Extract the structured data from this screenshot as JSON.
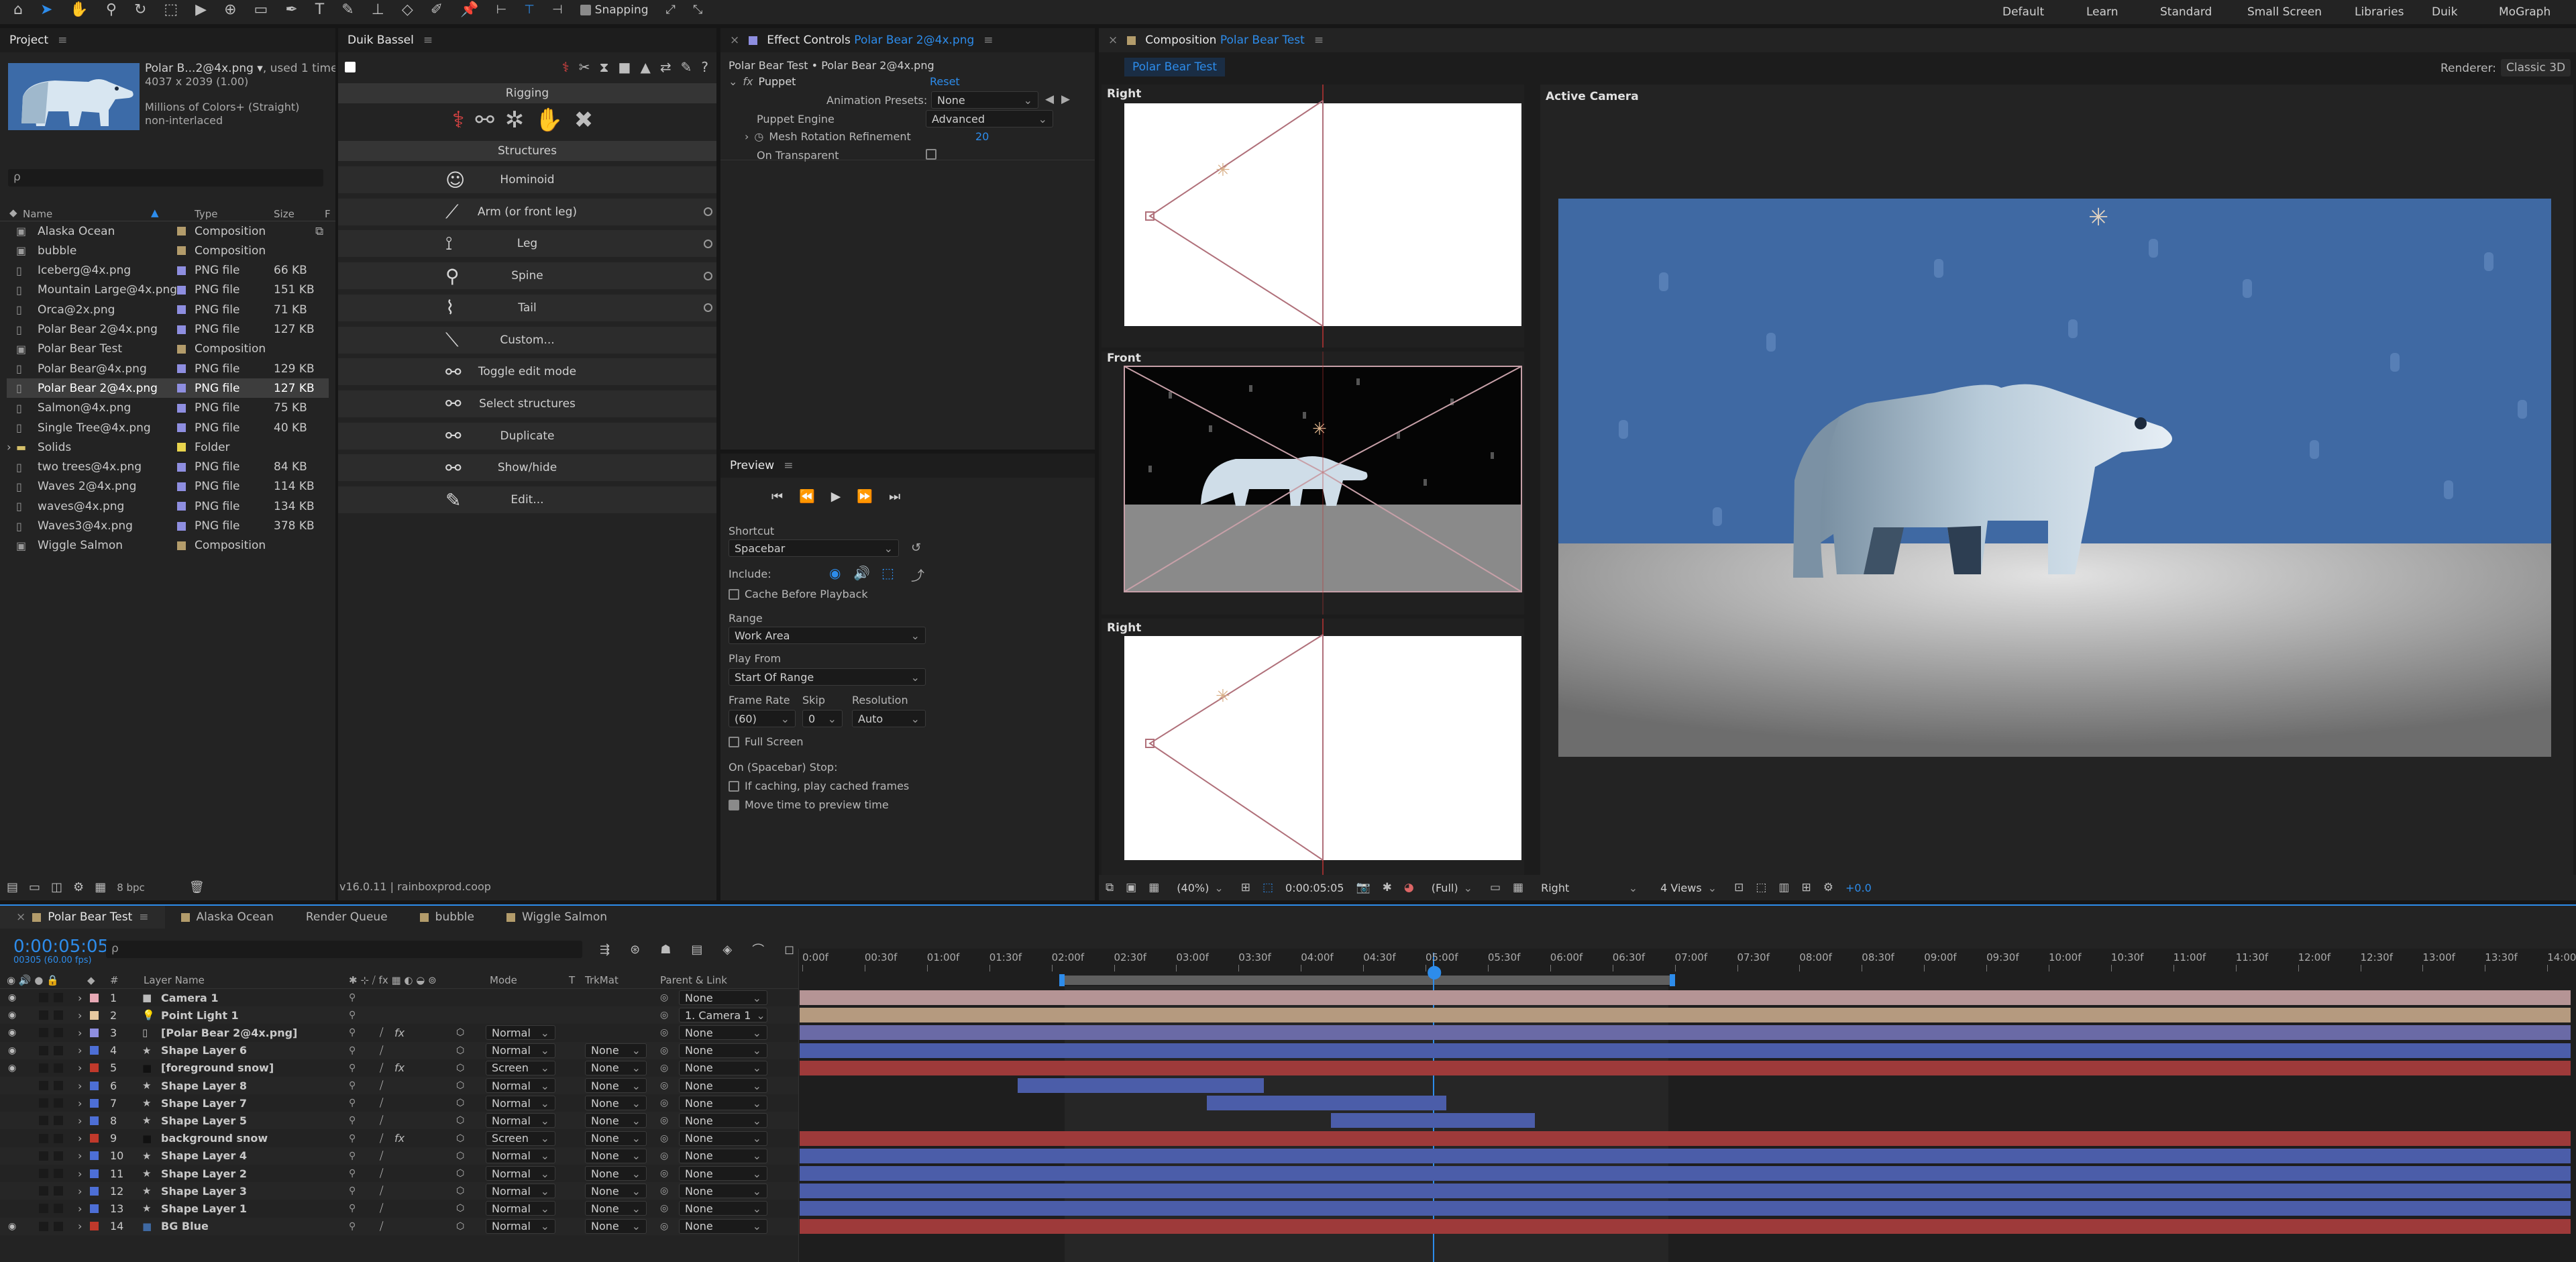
{
  "workspaces": [
    "Default",
    "Learn",
    "Standard",
    "Small Screen",
    "Libraries",
    "Duik",
    "MoGraph"
  ],
  "snapping_label": "Snapping",
  "project": {
    "tab": "Project",
    "filename": "Polar B...2@4x.png ▾",
    "used": ", used 1 time",
    "dims": "4037 x 2039 (1.00)",
    "colors": "Millions of Colors+ (Straight)",
    "interlace": "non-interlaced",
    "search_placeholder": "ρ",
    "col_name": "Name",
    "col_type": "Type",
    "col_size": "Size",
    "col_f": "F",
    "items": [
      {
        "name": "Alaska Ocean",
        "type": "Composition",
        "size": "",
        "color": "#b39c6b",
        "icon": "comp"
      },
      {
        "name": "bubble",
        "type": "Composition",
        "size": "",
        "color": "#b39c6b",
        "icon": "comp"
      },
      {
        "name": "Iceberg@4x.png",
        "type": "PNG file",
        "size": "66 KB",
        "color": "#8e8ee0",
        "icon": "file"
      },
      {
        "name": "Mountain Large@4x.png",
        "type": "PNG file",
        "size": "151 KB",
        "color": "#8e8ee0",
        "icon": "file"
      },
      {
        "name": "Orca@2x.png",
        "type": "PNG file",
        "size": "71 KB",
        "color": "#8e8ee0",
        "icon": "file"
      },
      {
        "name": "Polar Bear 2@4x.png",
        "type": "PNG file",
        "size": "127 KB",
        "color": "#8e8ee0",
        "icon": "file"
      },
      {
        "name": "Polar Bear Test",
        "type": "Composition",
        "size": "",
        "color": "#b39c6b",
        "icon": "comp"
      },
      {
        "name": "Polar Bear@4x.png",
        "type": "PNG file",
        "size": "129 KB",
        "color": "#8e8ee0",
        "icon": "file"
      },
      {
        "name": "Polar Bear 2@4x.png",
        "type": "PNG file",
        "size": "127 KB",
        "color": "#8e8ee0",
        "icon": "file",
        "selected": true
      },
      {
        "name": "Salmon@4x.png",
        "type": "PNG file",
        "size": "75 KB",
        "color": "#8e8ee0",
        "icon": "file"
      },
      {
        "name": "Single Tree@4x.png",
        "type": "PNG file",
        "size": "40 KB",
        "color": "#8e8ee0",
        "icon": "file"
      },
      {
        "name": "Solids",
        "type": "Folder",
        "size": "",
        "color": "#e8d44d",
        "icon": "folder"
      },
      {
        "name": "two trees@4x.png",
        "type": "PNG file",
        "size": "84 KB",
        "color": "#8e8ee0",
        "icon": "file"
      },
      {
        "name": "Waves 2@4x.png",
        "type": "PNG file",
        "size": "114 KB",
        "color": "#8e8ee0",
        "icon": "file"
      },
      {
        "name": "waves@4x.png",
        "type": "PNG file",
        "size": "134 KB",
        "color": "#8e8ee0",
        "icon": "file"
      },
      {
        "name": "Waves3@4x.png",
        "type": "PNG file",
        "size": "378 KB",
        "color": "#8e8ee0",
        "icon": "file"
      },
      {
        "name": "Wiggle Salmon",
        "type": "Composition",
        "size": "",
        "color": "#b39c6b",
        "icon": "comp"
      }
    ],
    "bpc": "8 bpc"
  },
  "duik": {
    "tab": "Duik Bassel",
    "rigging": "Rigging",
    "structures": "Structures",
    "buttons": [
      "Hominoid",
      "Arm (or front leg)",
      "Leg",
      "Spine",
      "Tail",
      "Custom...",
      "Toggle edit mode",
      "Select structures",
      "Duplicate",
      "Show/hide",
      "Edit..."
    ],
    "version": "v16.0.11 | rainboxprod.coop"
  },
  "effects": {
    "tab_prefix": "Effect Controls",
    "tab_layer": "Polar Bear 2@4x.png",
    "subtitle": "Polar Bear Test • Polar Bear 2@4x.png",
    "fx_name": "Puppet",
    "reset": "Reset",
    "anim_presets_label": "Animation Presets:",
    "anim_presets_value": "None",
    "engine_label": "Puppet Engine",
    "engine_value": "Advanced",
    "mesh_label": "Mesh Rotation Refinement",
    "mesh_value": "20",
    "transparent_label": "On Transparent"
  },
  "preview": {
    "tab": "Preview",
    "shortcut_label": "Shortcut",
    "shortcut_value": "Spacebar",
    "include_label": "Include:",
    "cache_label": "Cache Before Playback",
    "range_label": "Range",
    "range_value": "Work Area",
    "playfrom_label": "Play From",
    "playfrom_value": "Start Of Range",
    "framerate_label": "Frame Rate",
    "framerate_value": "(60)",
    "skip_label": "Skip",
    "skip_value": "0",
    "resolution_label": "Resolution",
    "resolution_value": "Auto",
    "fullscreen_label": "Full Screen",
    "stop_label": "On (Spacebar) Stop:",
    "ifcaching_label": "If caching, play cached frames",
    "movetime_label": "Move time to preview time"
  },
  "composition": {
    "tab_prefix": "Composition",
    "tab_comp": "Polar Bear Test",
    "subtab": "Polar Bear Test",
    "renderer_label": "Renderer:",
    "renderer_value": "Classic 3D",
    "view_right": "Right",
    "view_front": "Front",
    "view_right2": "Right",
    "active_camera": "Active Camera",
    "zoom": "(40%)",
    "timecode": "0:00:05:05",
    "quality": "(Full)",
    "view": "Right",
    "views": "4 Views",
    "exposure": "+0.0"
  },
  "timeline": {
    "tabs": [
      "Polar Bear Test",
      "Alaska Ocean",
      "Render Queue",
      "bubble",
      "Wiggle Salmon"
    ],
    "timecode": "0:00:05:05",
    "fps": "00305 (60.00 fps)",
    "search_placeholder": "ρ",
    "hdr_layer": "Layer Name",
    "hdr_mode": "Mode",
    "hdr_t": "T",
    "hdr_trkmat": "TrkMat",
    "hdr_parent": "Parent & Link",
    "ticks": [
      "0:00f",
      "00:30f",
      "01:00f",
      "01:30f",
      "02:00f",
      "02:30f",
      "03:00f",
      "03:30f",
      "04:00f",
      "04:30f",
      "05:00f",
      "05:30f",
      "06:00f",
      "06:30f",
      "07:00f",
      "07:30f",
      "08:00f",
      "08:30f",
      "09:00f",
      "09:30f",
      "10:00f",
      "10:30f",
      "11:00f",
      "11:30f",
      "12:00f",
      "12:30f",
      "13:00f",
      "13:30f",
      "14:00f"
    ],
    "layers": [
      {
        "num": "1",
        "name": "Camera 1",
        "type": "camera",
        "label": "#e7a9b5",
        "mode": "",
        "trk": "",
        "parent": "None",
        "bar": "#b59495",
        "start": 0,
        "end": 100
      },
      {
        "num": "2",
        "name": "Point Light 1",
        "type": "light",
        "label": "#e7c9a0",
        "mode": "",
        "trk": "",
        "parent": "1. Camera 1",
        "bar": "#b59a7f",
        "start": 0,
        "end": 100
      },
      {
        "num": "3",
        "name": "[Polar Bear 2@4x.png]",
        "type": "footage",
        "label": "#8e8ee0",
        "mode": "Normal",
        "trk": "",
        "parent": "None",
        "bar": "#6a6aa6",
        "start": 0,
        "end": 100
      },
      {
        "num": "4",
        "name": "Shape Layer 6",
        "type": "shape",
        "label": "#4d6fd6",
        "mode": "Normal",
        "trk": "None",
        "parent": "None",
        "bar": "#4b5da9",
        "start": 0,
        "end": 100
      },
      {
        "num": "5",
        "name": "[foreground snow]",
        "type": "solid",
        "label": "#c0392b",
        "mode": "Screen",
        "trk": "None",
        "parent": "None",
        "bar": "#9e3a3a",
        "start": 0,
        "end": 100
      },
      {
        "num": "6",
        "name": "Shape Layer 8",
        "type": "shape",
        "label": "#4d6fd6",
        "mode": "Normal",
        "trk": "None",
        "parent": "None",
        "bar": "#4b5da9",
        "start": 12.3,
        "end": 26.2
      },
      {
        "num": "7",
        "name": "Shape Layer 7",
        "type": "shape",
        "label": "#4d6fd6",
        "mode": "Normal",
        "trk": "None",
        "parent": "None",
        "bar": "#4b5da9",
        "start": 23,
        "end": 36.5
      },
      {
        "num": "8",
        "name": "Shape Layer 5",
        "type": "shape",
        "label": "#4d6fd6",
        "mode": "Normal",
        "trk": "None",
        "parent": "None",
        "bar": "#4b5da9",
        "start": 30,
        "end": 41.5
      },
      {
        "num": "9",
        "name": "background snow",
        "type": "solid",
        "label": "#c0392b",
        "mode": "Screen",
        "trk": "None",
        "parent": "None",
        "bar": "#9e3a3a",
        "start": 0,
        "end": 100
      },
      {
        "num": "10",
        "name": "Shape Layer 4",
        "type": "shape",
        "label": "#4d6fd6",
        "mode": "Normal",
        "trk": "None",
        "parent": "None",
        "bar": "#4b5da9",
        "start": 0,
        "end": 100
      },
      {
        "num": "11",
        "name": "Shape Layer 2",
        "type": "shape",
        "label": "#4d6fd6",
        "mode": "Normal",
        "trk": "None",
        "parent": "None",
        "bar": "#4b5da9",
        "start": 0,
        "end": 100
      },
      {
        "num": "12",
        "name": "Shape Layer 3",
        "type": "shape",
        "label": "#4d6fd6",
        "mode": "Normal",
        "trk": "None",
        "parent": "None",
        "bar": "#4b5da9",
        "start": 0,
        "end": 100
      },
      {
        "num": "13",
        "name": "Shape Layer 1",
        "type": "shape",
        "label": "#4d6fd6",
        "mode": "Normal",
        "trk": "None",
        "parent": "None",
        "bar": "#4b5da9",
        "start": 0,
        "end": 100
      },
      {
        "num": "14",
        "name": "BG Blue",
        "type": "solid",
        "label": "#c0392b",
        "mode": "Normal",
        "trk": "None",
        "parent": "None",
        "bar": "#9e3a3a",
        "start": 0,
        "end": 100
      }
    ]
  }
}
